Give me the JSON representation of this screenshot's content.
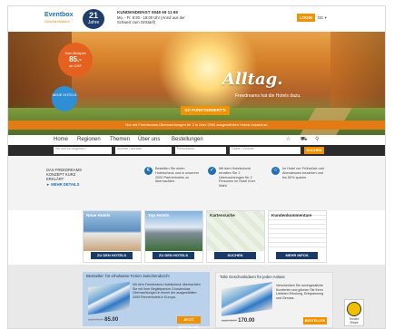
{
  "header": {
    "logo_text": "Eventbox",
    "logo_sub": "Geschenkideen",
    "seal_num": "21",
    "seal_text": "Jahre",
    "hotline_title": "KUNDENDIENST 0848 69 11 69",
    "hotline_line2": "Mo. - Fr. 8:30 - 18:00 Uhr (Anruf aus der",
    "hotline_line3": "Schweiz zum Ortstarif)",
    "login_label": "LOGIN",
    "lang_label": "DE ▾"
  },
  "hero": {
    "badge_line1": "Zum Beispiel",
    "badge_price": "85.-",
    "badge_line3": "ab CHF",
    "badge2_text": "NEUE HOTELS",
    "title": "Alltag.",
    "subtitle": "Freedreams hat die Hotels dazu.",
    "cta_label": "SO FUNKTIONIERT'S",
    "strip_text": "Nur mit Freedreams-Übernachtungen für 2 in über 2000 ausgewählten Hotels kostenlos!"
  },
  "nav": {
    "items": [
      "Home",
      "Regionen",
      "Themen",
      "Über uns",
      "Bestellungen"
    ],
    "icons": [
      "star-icon",
      "cart-icon",
      "search-icon"
    ]
  },
  "search": {
    "field1": "Wo soll es hingehen?",
    "field2": "Anreise / Abreise",
    "field3": "Reisedatum",
    "field4": "Gäste / Zimmer",
    "button_label": "SUCHEN"
  },
  "info": {
    "head_line1": "DAS FREEDREAMS",
    "head_line2": "KONZEPT KURZ ERKLÄRT",
    "head_more": "► MEHR DETAILS",
    "items": [
      {
        "icon": "€",
        "text": "Bestellen Sie einen Hotelscheck und in unserem 2000 Partnerhotels zu übernachten."
      },
      {
        "icon": "✓",
        "text": "Mit dem Hotelscheck erhalten Sie 2 Übernachtungen für 2 Personen im Hotel Ihrer Wahl."
      },
      {
        "icon": "☆",
        "text": "Im Hotel nur Frühstück und Abendessen bezahlen und bis 50% sparen."
      }
    ]
  },
  "cards": [
    {
      "title": "Neue Hotels",
      "button": "ZU DEN HOTELS"
    },
    {
      "title": "Top Hotels",
      "button": "ZU DEN HOTELS"
    },
    {
      "title": "Kartensuche",
      "button": "SUCHEN"
    },
    {
      "title": "Kundenkommentare",
      "button": "MEHR INFOS"
    }
  ],
  "bottom": {
    "panel1_title": "Bestseller: für erholsame Ferien zwischendurch!",
    "panel1_body": "Mit dem Freedreams Hotelscheck übernachten Sie mit Ihrer Begleitperson 3 kostenlose Übernachtungen in einem der ausgewählten 2000 Partnerhotels in Europa.",
    "panel1_old": "statt CHF",
    "panel1_price": "85.00",
    "panel1_btn": "JETZT BESTELLEN",
    "panel2_title": "Tolle Geschenkideen für jeden Anlass",
    "panel2_body": "Verschenken Sie unvergessliche Kurzferien und gönnen Sie Ihren Liebsten Erholung, Entspannung und Genuss.",
    "panel2_old": "statt CHF",
    "panel2_price": "170.00",
    "panel2_btn": "BESTELLEN",
    "seal_text": "Trusted Shops"
  }
}
